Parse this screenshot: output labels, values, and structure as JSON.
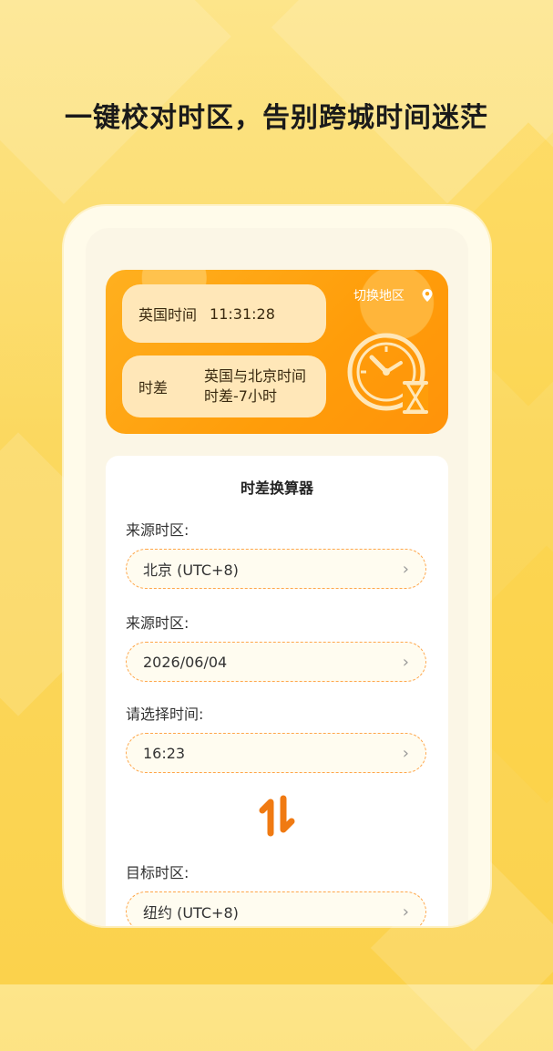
{
  "headline": "一键校对时区，告别跨城时间迷茫",
  "banner": {
    "time_label": "英国时间",
    "time_value": "11:31:28",
    "diff_label": "时差",
    "diff_line1": "英国与北京时间",
    "diff_line2": "时差-7小时",
    "switch_label": "切换地区"
  },
  "calculator": {
    "title": "时差换算器",
    "source_tz_label": "来源时区:",
    "source_tz_value": "北京 (UTC+8)",
    "date_label": "来源时区:",
    "date_value": "2026/06/04",
    "time_label": "请选择时间:",
    "time_value": "16:23",
    "target_tz_label": "目标时区:",
    "target_tz_value": "纽约 (UTC+8)"
  },
  "colors": {
    "accent": "#ff9d0a",
    "swap_icon": "#f07a12",
    "background": "#fbd85f"
  }
}
